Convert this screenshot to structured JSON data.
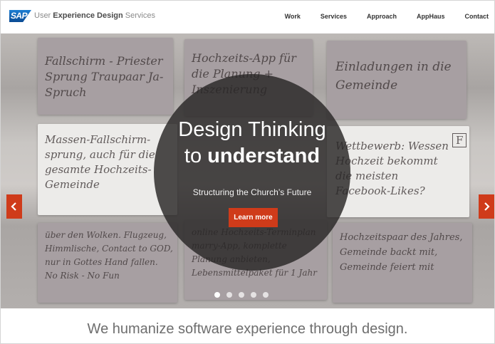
{
  "header": {
    "logo_text": "SAP",
    "brand_prefix": "User ",
    "brand_bold": "Experience Design",
    "brand_suffix": " Services",
    "nav": [
      "Work",
      "Services",
      "Approach",
      "AppHaus",
      "Contact"
    ]
  },
  "hero": {
    "title_line1": "Design Thinking",
    "title_line2_prefix": "to ",
    "title_line2_bold": "understand",
    "subtitle": "Structuring the Church’s Future",
    "cta_label": "Learn more",
    "slide_count": 5,
    "active_slide": 1,
    "prev_icon": "chevron-left-icon",
    "next_icon": "chevron-right-icon",
    "notes": [
      "Fallschirm - Priester Sprung Traupaar Ja-Spruch",
      "Hochzeits-App für die Planung + Inszenierung",
      "Einladungen in die Gemeinde",
      "Massen-Fallschirm-sprung, auch für die gesamte Hochzeits-Gemeinde",
      "Wettbewerb: Wessen Hochzeit bekommt die meisten Facebook-Likes?",
      "über den Wolken. Flugzeug, Himmlische, Contact to GOD, nur in Gottes Hand fallen. No Risk - No Fun",
      "online Hochzeits-Terminplan marry-App, komplette Planung anbieten, Lebensmittelpaket für 1 Jahr",
      "Hochzeitspaar des Jahres, Gemeinde backt mit, Gemeinde feiert mit"
    ],
    "note_badge": "F"
  },
  "tagline": "We humanize software experience through design.",
  "colors": {
    "accent": "#cf3b1a",
    "brand_blue": "#0a4a93"
  }
}
